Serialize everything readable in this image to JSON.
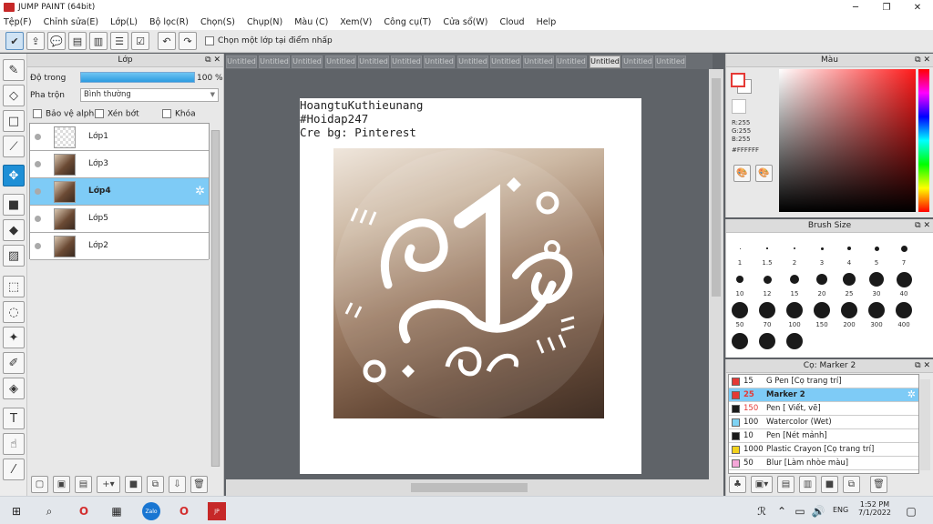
{
  "window": {
    "title": "JUMP PAINT (64bit)",
    "minimize": "─",
    "restore": "❐",
    "close": "✕"
  },
  "menu": [
    "Tệp(F)",
    "Chỉnh sửa(E)",
    "Lớp(L)",
    "Bộ lọc(R)",
    "Chọn(S)",
    "Chụp(N)",
    "Màu (C)",
    "Xem(V)",
    "Công cụ(T)",
    "Cửa sổ(W)",
    "Cloud",
    "Help"
  ],
  "toolbar": {
    "select_layer_label": "Chọn một lớp tại điểm nhấp"
  },
  "layer_panel": {
    "title": "Lớp",
    "opacity_label": "Độ trong",
    "opacity_value": "100 %",
    "opacity_fraction": 1.0,
    "blend_label": "Pha trộn",
    "blend_value": "Bình thường",
    "protect_alpha": "Bảo vệ alpha",
    "clipping": "Xén bớt",
    "lock": "Khóa",
    "layers": [
      {
        "name": "Lớp1",
        "selected": false,
        "thumb": "checker"
      },
      {
        "name": "Lớp3",
        "selected": false,
        "thumb": "photo"
      },
      {
        "name": "Lớp4",
        "selected": true,
        "thumb": "photo"
      },
      {
        "name": "Lớp5",
        "selected": false,
        "thumb": "photo"
      },
      {
        "name": "Lớp2",
        "selected": false,
        "thumb": "photo"
      }
    ]
  },
  "tabs": [
    "Untitled",
    "Untitled",
    "Untitled",
    "Untitled",
    "Untitled",
    "Untitled",
    "Untitled",
    "Untitled",
    "Untitled",
    "Untitled",
    "Untitled",
    "Untitled",
    "Untitled",
    "Untitled"
  ],
  "active_tab_index": 11,
  "canvas": {
    "lines": [
      "HoangtuKuthieunang",
      "#Hoidap247",
      "Cre bg: Pinterest"
    ]
  },
  "color_panel": {
    "title": "Màu",
    "r": "R:255",
    "g": "G:255",
    "b": "B:255",
    "hex": "#FFFFFF",
    "accent_color": "#e53935"
  },
  "brush_panel": {
    "title": "Brush Size",
    "sizes": [
      "1",
      "1.5",
      "2",
      "3",
      "4",
      "5",
      "7",
      "10",
      "12",
      "15",
      "20",
      "25",
      "30",
      "40",
      "50",
      "70",
      "100",
      "150",
      "200",
      "300",
      "400",
      "",
      "",
      ""
    ]
  },
  "pen_panel": {
    "title": "Cọ: Marker 2",
    "pens": [
      {
        "size": "15",
        "name": "G Pen [Cọ trang trí]",
        "color": "#e53935",
        "selected": false
      },
      {
        "size": "25",
        "name": "Marker 2",
        "color": "#e53935",
        "selected": true
      },
      {
        "size": "150",
        "name": "Pen [ Viết, vẽ]",
        "color": "#1a1a1a",
        "selected": false
      },
      {
        "size": "100",
        "name": "Watercolor (Wet)",
        "color": "#7ed3f4",
        "selected": false
      },
      {
        "size": "10",
        "name": "Pen [Nét mảnh]",
        "color": "#1a1a1a",
        "selected": false
      },
      {
        "size": "1000",
        "name": "Plastic Crayon [Cọ trang trí]",
        "color": "#f2d21b",
        "selected": false
      },
      {
        "size": "50",
        "name": "Blur [Làm nhòe màu]",
        "color": "#f5a6d8",
        "selected": false
      }
    ]
  },
  "taskbar": {
    "lang": "ENG",
    "time": "1:52 PM",
    "date": "7/1/2022"
  }
}
